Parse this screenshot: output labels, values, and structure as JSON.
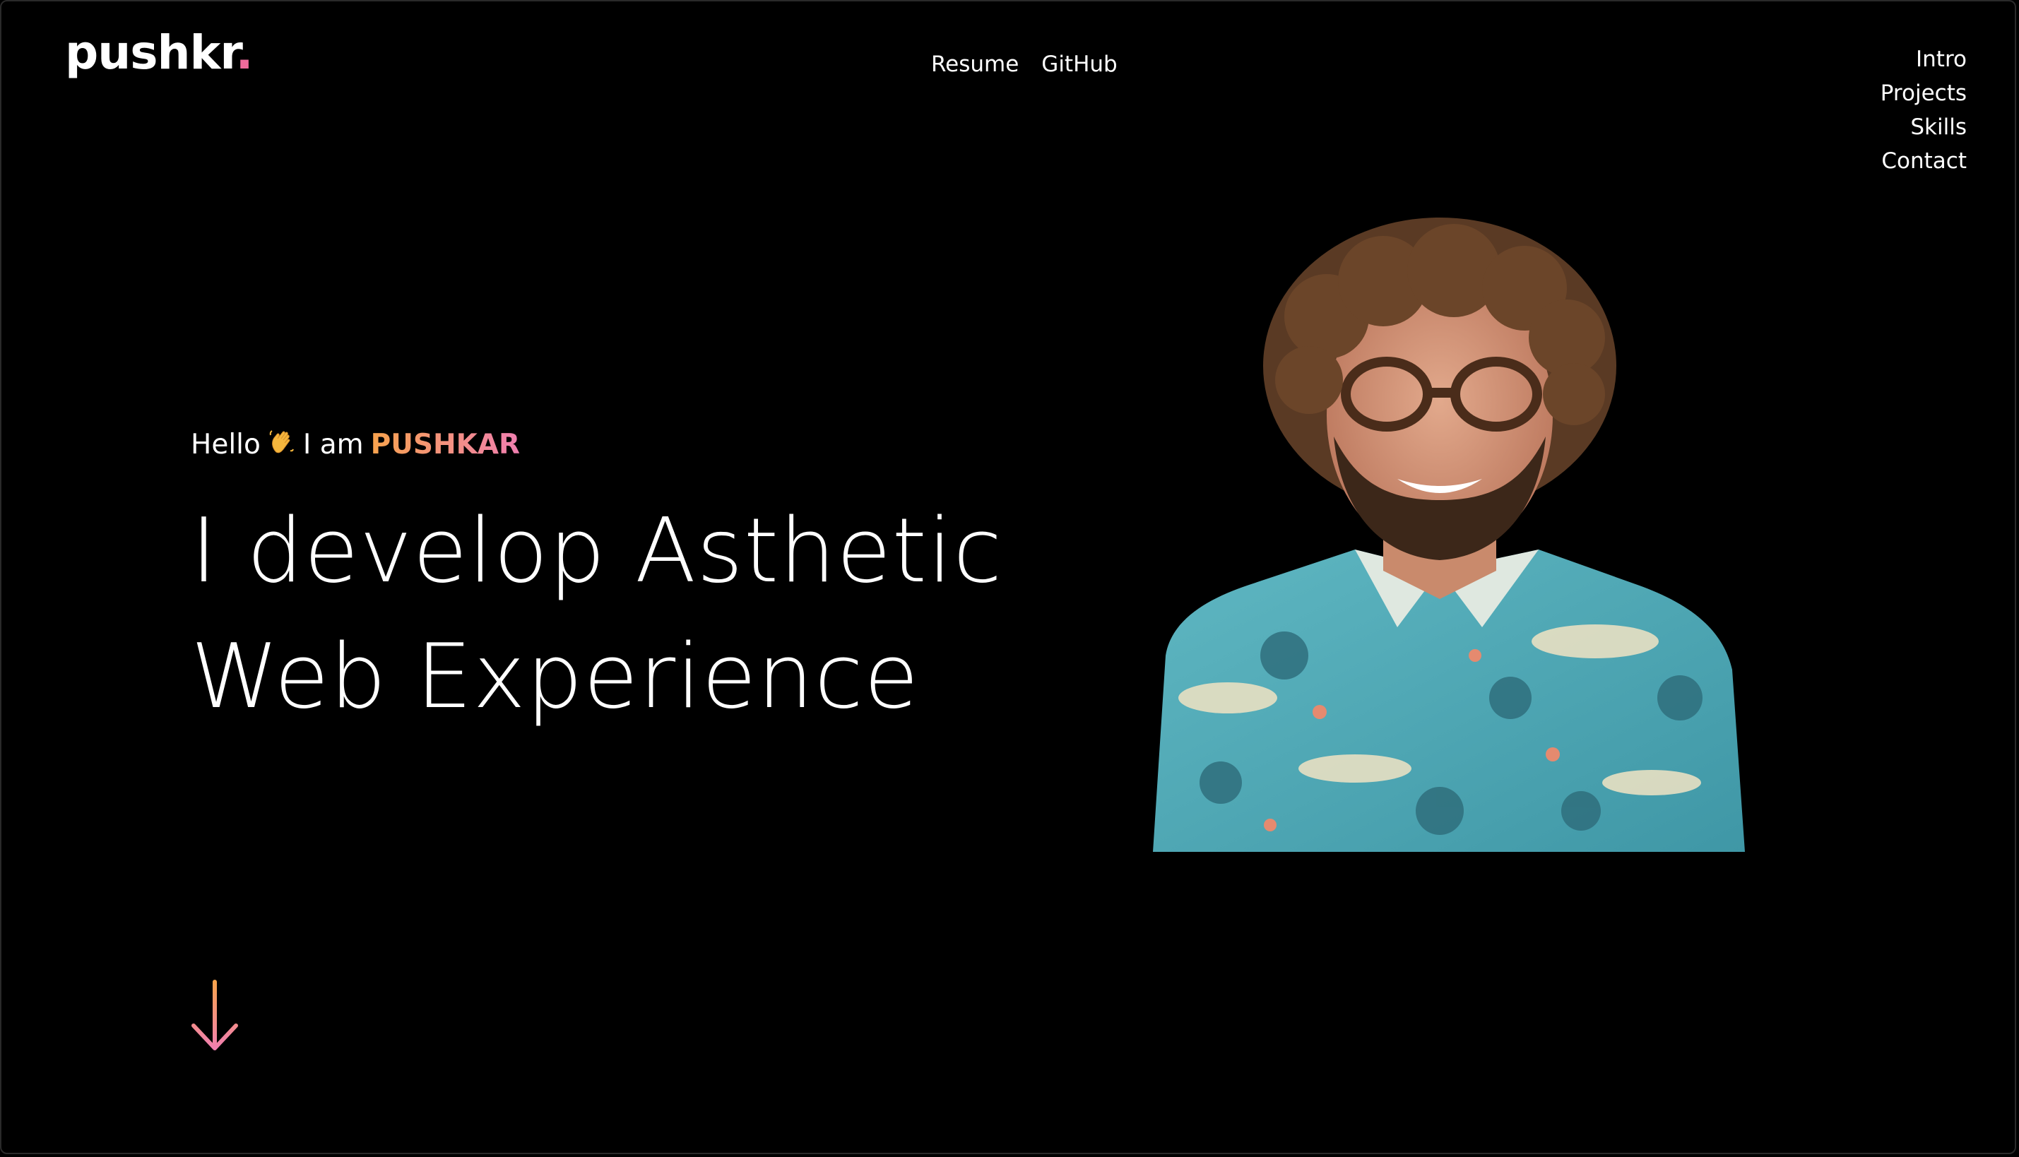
{
  "brand": {
    "text": "pushkr",
    "dot": ".",
    "dot_color": "#f06a9c"
  },
  "top_links": [
    {
      "label": "Resume"
    },
    {
      "label": "GitHub"
    }
  ],
  "side_nav": [
    {
      "label": "Intro"
    },
    {
      "label": "Projects"
    },
    {
      "label": "Skills"
    },
    {
      "label": "Contact"
    }
  ],
  "hero": {
    "greeting_prefix": "Hello",
    "greeting_middle": "I am",
    "name": "PUSHKAR",
    "headline_line1": "I develop Asthetic",
    "headline_line2": "Web Experience"
  },
  "icons": {
    "wave": "waving-hand-icon",
    "scroll": "arrow-down-icon"
  },
  "colors": {
    "background": "#000000",
    "text": "#ffffff",
    "gradient_start": "#f8a34d",
    "gradient_end": "#f07fb0"
  }
}
